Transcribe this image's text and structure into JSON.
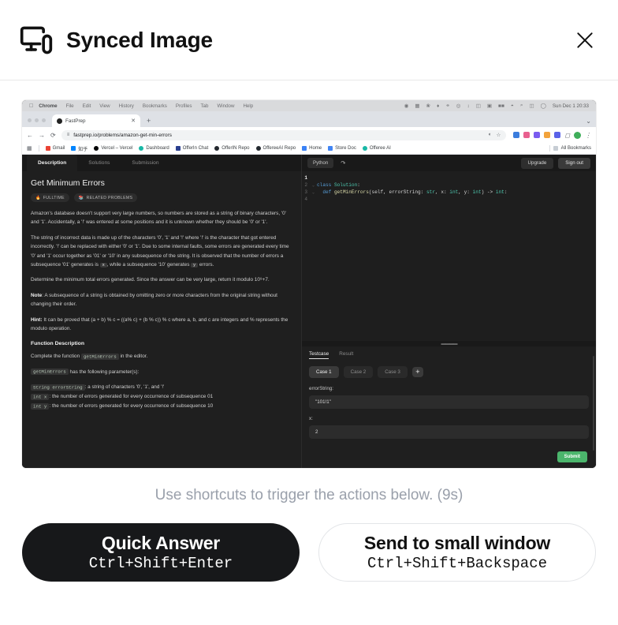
{
  "header": {
    "title": "Synced Image",
    "icon": "device-sync-icon",
    "close_label": "✕"
  },
  "screenshot": {
    "macos": {
      "apple_icon": "apple-logo-icon",
      "menus": [
        "Chrome",
        "File",
        "Edit",
        "View",
        "History",
        "Bookmarks",
        "Profiles",
        "Tab",
        "Window",
        "Help"
      ],
      "status_icons": [
        "screen-record-icon",
        "grid-icon",
        "bluetooth-icon",
        "droplet-icon",
        "link-icon",
        "record-icon",
        "arrow-icon",
        "columns-icon",
        "display-icon",
        "battery-icon",
        "wifi-icon",
        "search-icon",
        "control-center-icon",
        "siri-icon"
      ],
      "clock": "Sun Dec 1  20:33"
    },
    "browser": {
      "tab_title": "FastPrep",
      "tab_close": "✕",
      "new_tab": "+",
      "tabstrip_menu": "⌄",
      "nav": {
        "back": "←",
        "forward": "→",
        "reload": "⟳"
      },
      "url": "fastprep.io/problems/amazon-get-min-errors",
      "omni_icons": [
        "eye-off-icon",
        "star-icon"
      ],
      "extensions": [
        "extension-blue-icon",
        "extension-pink-icon",
        "extension-purple-icon",
        "extension-orange-icon",
        "extension-indigo-icon",
        "extension-puzzle-icon"
      ],
      "profile": "profile-avatar",
      "menu": "⋮",
      "bookmarks": [
        {
          "label": "Gmail",
          "color": "#ea4335"
        },
        {
          "label": "知乎",
          "color": "#0084ff"
        },
        {
          "label": "Vercel – Vercel",
          "color": "#000000"
        },
        {
          "label": "Dashboard",
          "color": "#18b8a6"
        },
        {
          "label": "OfferIn Chat",
          "color": "#2a3f8f"
        },
        {
          "label": "OfferIN Repo",
          "color": "#24292f"
        },
        {
          "label": "OffereeAI Repo",
          "color": "#24292f"
        },
        {
          "label": "Home",
          "color": "#3b82f6"
        },
        {
          "label": "Store Doc",
          "color": "#4285f4"
        },
        {
          "label": "Offeree AI",
          "color": "#18b8a6"
        }
      ],
      "all_bookmarks": "All Bookmarks"
    },
    "problem": {
      "tabs": [
        {
          "label": "Description",
          "active": true
        },
        {
          "label": "Solutions",
          "active": false
        },
        {
          "label": "Submission",
          "active": false
        }
      ],
      "title": "Get Minimum Errors",
      "badges": [
        {
          "icon": "fire-icon",
          "label": "FULLTIME"
        },
        {
          "icon": "books-icon",
          "label": "RELATED PROBLEMS"
        }
      ],
      "paragraphs": [
        "Amazon's database doesn't support very large numbers, so numbers are stored as a string of binary characters, '0' and '1'. Accidentally, a '!' was entered at some positions and it is unknown whether they should be '0' or '1'.",
        "The string of incorrect data is made up of the characters '0', '1' and '!' where '!' is the character that got entered incorrectly. '!' can be replaced with either '0' or '1'. Due to some internal faults, some errors are generated every time '0' and '1' occur together as '01' or '10' in any subsequence of the string. It is observed that the number of errors a subsequence '01' generates is x, while a subsequence '10' generates y errors.",
        "Determine the minimum total errors generated. Since the answer can be very large, return it modulo 10⁹+7."
      ],
      "note_label": "Note",
      "note_text": ": A subsequence of a string is obtained by omitting zero or more characters from the original string without changing their order.",
      "hint_label": "Hint:",
      "hint_text": " It can be proved that (a + b) % c = ((a% c) + (b % c)) % c where a, b, and c are integers and % represents the modulo operation.",
      "func_section_title": "Function Description",
      "func_line1_pre": "Complete the function ",
      "func_name": "getMinErrors",
      "func_line1_post": " in the editor.",
      "func_line2_post": " has the following parameter(s):",
      "params": [
        {
          "code": "String errorString",
          "desc": ": a string of characters '0', '1', and '!'"
        },
        {
          "code": "int x",
          "desc": ": the number of errors generated for every occurrence of subsequence 01"
        },
        {
          "code": "int y",
          "desc": ": the number of errors generated for every occurrence of subsequence 10"
        }
      ]
    },
    "editor": {
      "language": "Python",
      "reset_icon": "reset-icon",
      "upgrade_label": "Upgrade",
      "signout_label": "Sign out",
      "lines": [
        {
          "num": "1",
          "fold": "",
          "text": ""
        },
        {
          "num": "2",
          "fold": "⌄",
          "text": "class Solution:"
        },
        {
          "num": "3",
          "fold": "⌄",
          "text": "    def getMinErrors(self, errorString: str, x: int, y: int) -> int:"
        },
        {
          "num": "4",
          "fold": "",
          "text": ""
        }
      ]
    },
    "testcase": {
      "tabs": [
        {
          "label": "Testcase",
          "active": true
        },
        {
          "label": "Result",
          "active": false
        }
      ],
      "cases": [
        {
          "label": "Case 1",
          "active": true
        },
        {
          "label": "Case 2",
          "active": false
        },
        {
          "label": "Case 3",
          "active": false
        }
      ],
      "add_case": "+",
      "fields": [
        {
          "label": "errorString:",
          "value": "\"101!1\""
        },
        {
          "label": "x:",
          "value": "2"
        }
      ],
      "submit_label": "Submit"
    }
  },
  "footer": {
    "hint": "Use shortcuts to trigger the actions below. (9s)",
    "actions": [
      {
        "title": "Quick Answer",
        "keys": "Ctrl+Shift+Enter",
        "style": "primary"
      },
      {
        "title": "Send to small window",
        "keys": "Ctrl+Shift+Backspace",
        "style": "secondary"
      }
    ]
  }
}
